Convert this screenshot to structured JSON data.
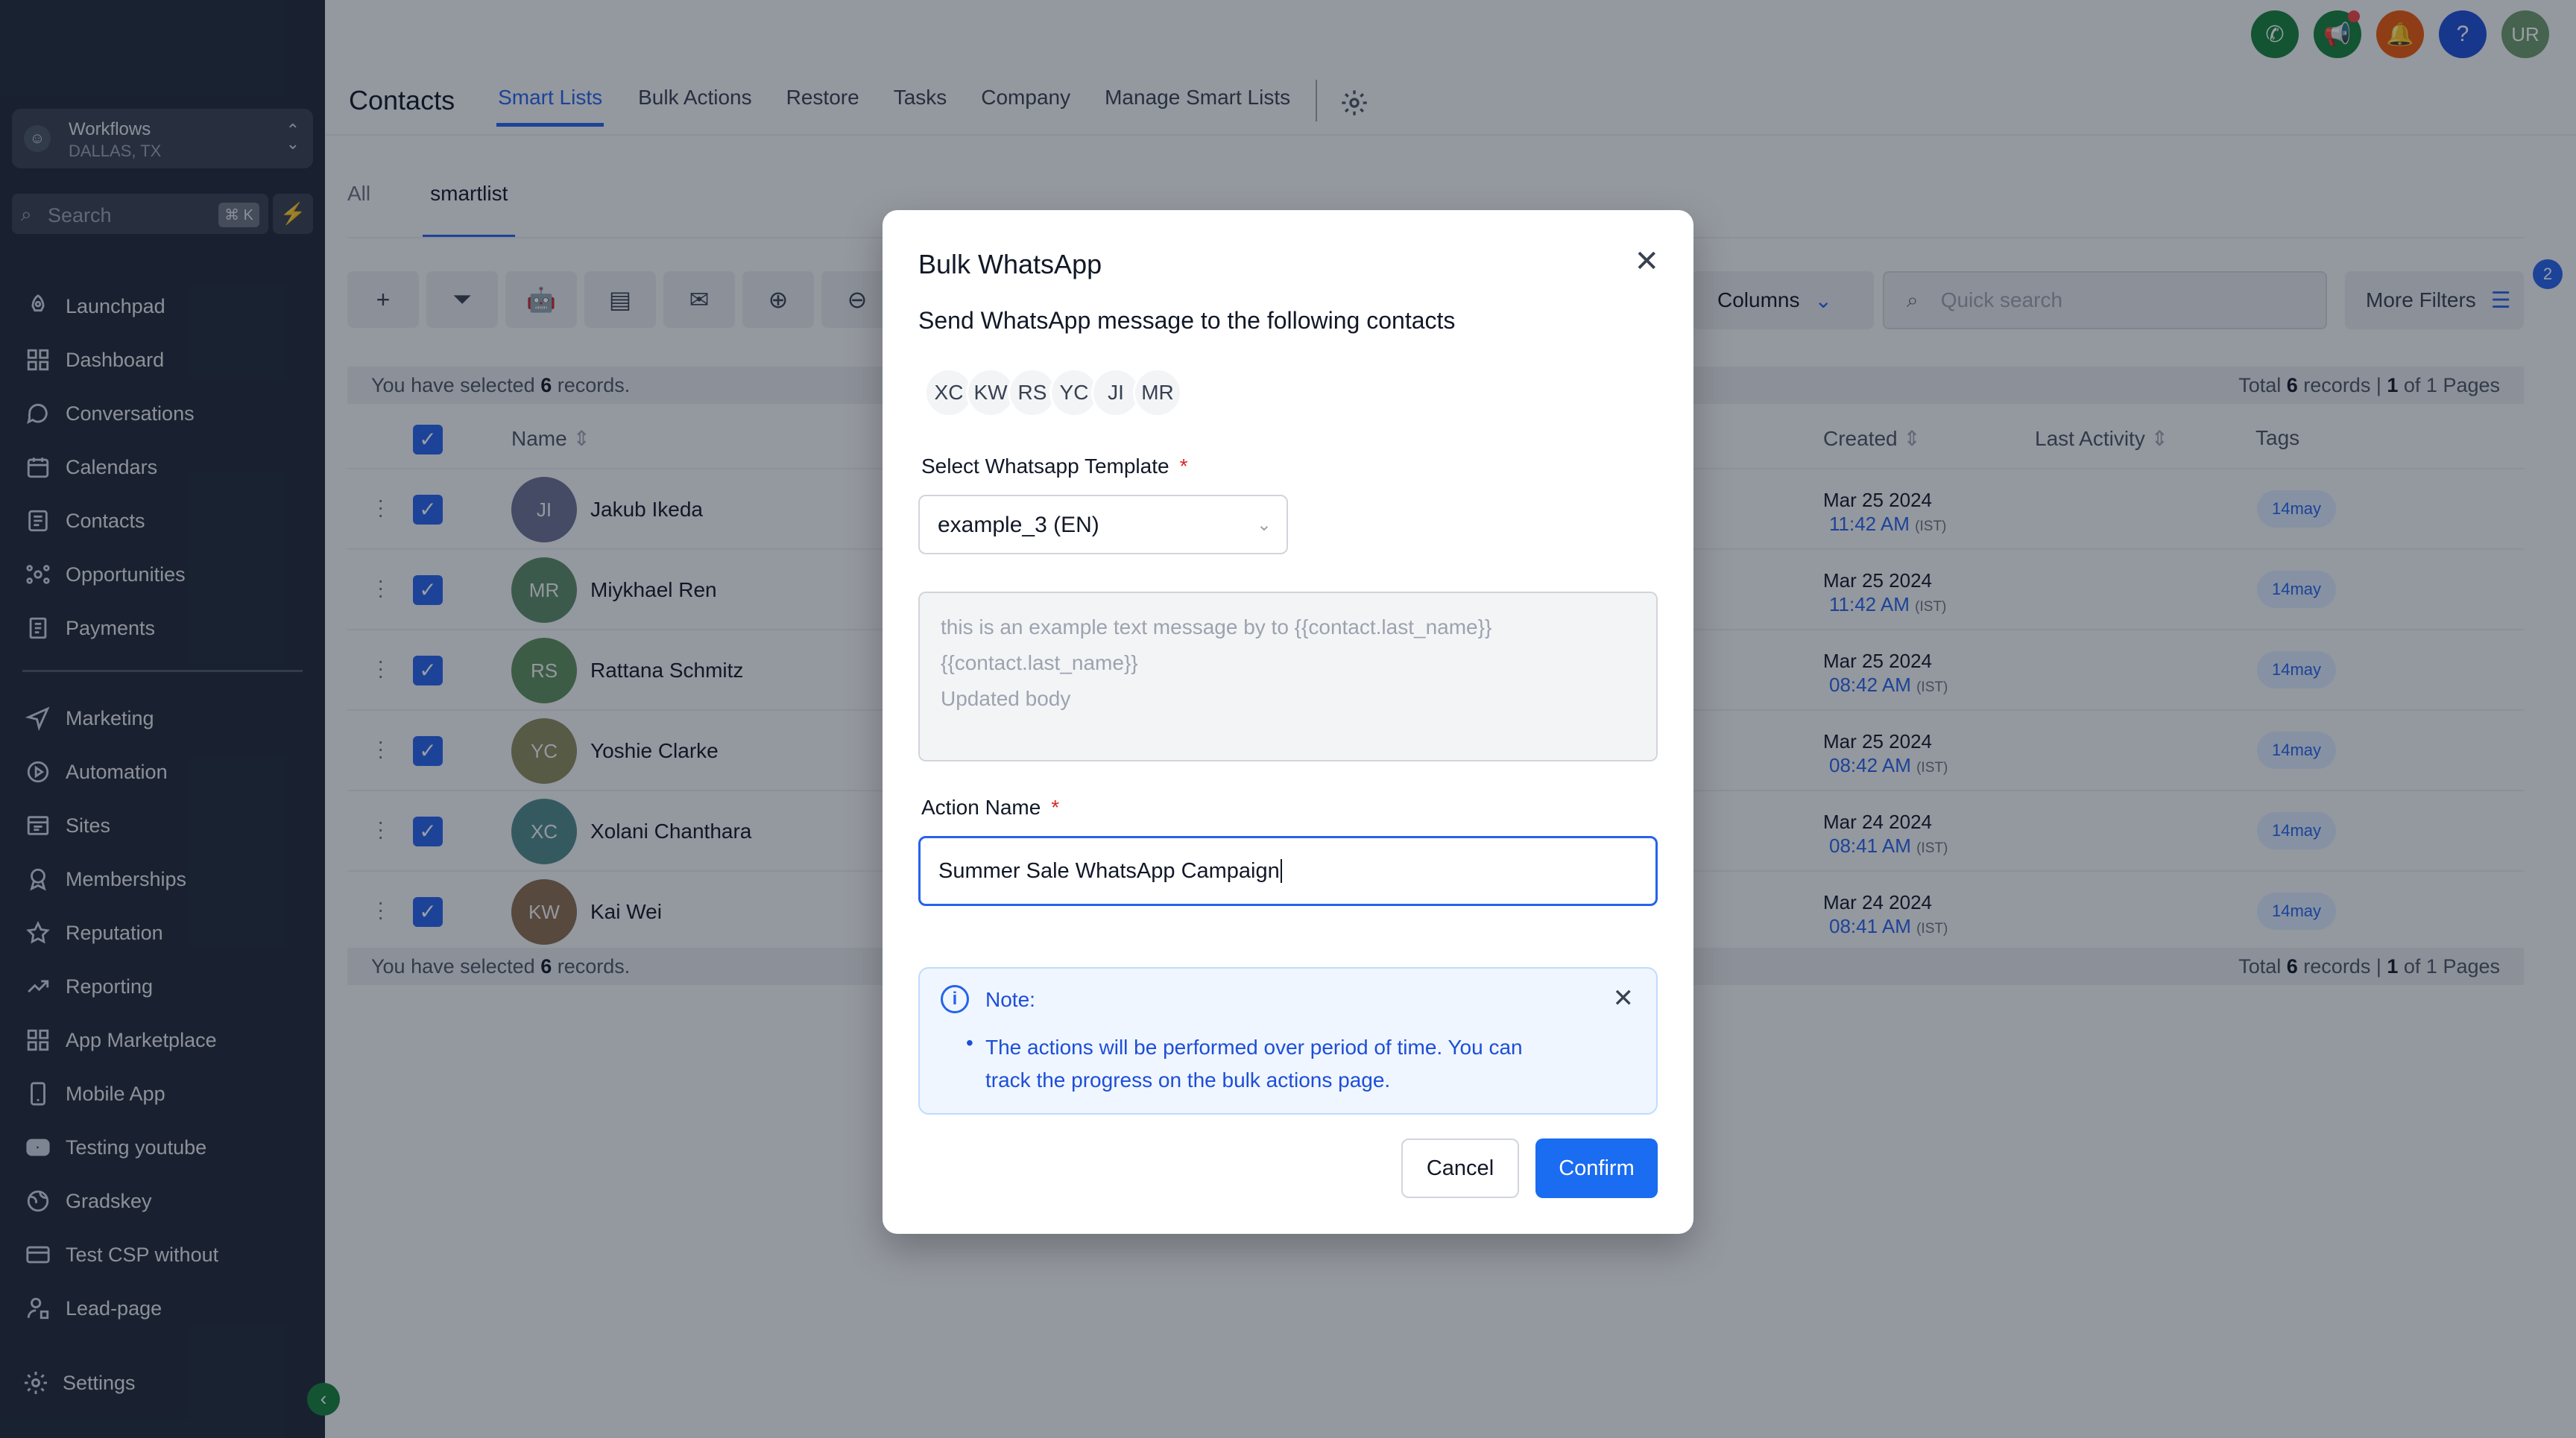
{
  "sidebar": {
    "location": {
      "name": "Workflows",
      "city": "DALLAS, TX",
      "avatar": "☺"
    },
    "search": {
      "placeholder": "Search",
      "shortcut": "⌘ K"
    },
    "items": [
      {
        "label": "Launchpad",
        "icon": "rocket-icon"
      },
      {
        "label": "Dashboard",
        "icon": "dashboard-icon"
      },
      {
        "label": "Conversations",
        "icon": "chat-icon"
      },
      {
        "label": "Calendars",
        "icon": "calendar-icon"
      },
      {
        "label": "Contacts",
        "icon": "contacts-icon"
      },
      {
        "label": "Opportunities",
        "icon": "opportunities-icon"
      },
      {
        "label": "Payments",
        "icon": "payments-icon"
      }
    ],
    "items2": [
      {
        "label": "Marketing",
        "icon": "send-icon"
      },
      {
        "label": "Automation",
        "icon": "automation-icon"
      },
      {
        "label": "Sites",
        "icon": "sites-icon"
      },
      {
        "label": "Memberships",
        "icon": "memberships-icon"
      },
      {
        "label": "Reputation",
        "icon": "star-icon"
      },
      {
        "label": "Reporting",
        "icon": "reporting-icon"
      },
      {
        "label": "App Marketplace",
        "icon": "grid-icon"
      },
      {
        "label": "Mobile App",
        "icon": "mobile-icon"
      },
      {
        "label": "Testing youtube",
        "icon": "youtube-icon"
      },
      {
        "label": "Gradskey",
        "icon": "globe-icon"
      },
      {
        "label": "Test CSP without",
        "icon": "card-icon"
      },
      {
        "label": "Lead-page",
        "icon": "user-lock-icon"
      }
    ],
    "settings_label": "Settings"
  },
  "header": {
    "title": "Contacts",
    "tabs": [
      "Smart Lists",
      "Bulk Actions",
      "Restore",
      "Tasks",
      "Company",
      "Manage Smart Lists"
    ],
    "active_tab": "Smart Lists",
    "user_initials": "UR",
    "colors": {
      "phone": "#15803d",
      "megaphone": "#15803d",
      "bell": "#ea580c",
      "help": "#1d4ed8",
      "avatar": "#6b9a6b"
    }
  },
  "subtabs": [
    "All",
    "smartlist"
  ],
  "toolbar": {
    "columns_label": "Columns",
    "quick_search_placeholder": "Quick search",
    "more_filters_label": "More Filters",
    "filters_badge": "2"
  },
  "selection": {
    "prefix": "You have selected",
    "count": "6",
    "suffix": "records.",
    "total_prefix": "Total",
    "total_count": "6",
    "total_mid": "records |",
    "page": "1",
    "page_mid": "of 1 Pages"
  },
  "table": {
    "headers": {
      "name": "Name",
      "created": "Created",
      "last_activity": "Last Activity",
      "tags": "Tags"
    },
    "rows": [
      {
        "initials": "JI",
        "name": "Jakub Ikeda",
        "date": "Mar 25 2024",
        "time": "11:42 AM",
        "tz": "(IST)",
        "tag": "14may",
        "color": "#6b6f93"
      },
      {
        "initials": "MR",
        "name": "Miykhael Ren",
        "date": "Mar 25 2024",
        "time": "11:42 AM",
        "tz": "(IST)",
        "tag": "14may",
        "color": "#5c8a66"
      },
      {
        "initials": "RS",
        "name": "Rattana Schmitz",
        "date": "Mar 25 2024",
        "time": "08:42 AM",
        "tz": "(IST)",
        "tag": "14may",
        "color": "#5e8e5e"
      },
      {
        "initials": "YC",
        "name": "Yoshie Clarke",
        "date": "Mar 25 2024",
        "time": "08:42 AM",
        "tz": "(IST)",
        "tag": "14may",
        "color": "#8a8a5c"
      },
      {
        "initials": "XC",
        "name": "Xolani Chanthara",
        "date": "Mar 24 2024",
        "time": "08:41 AM",
        "tz": "(IST)",
        "tag": "14may",
        "color": "#4f8a8a"
      },
      {
        "initials": "KW",
        "name": "Kai Wei",
        "date": "Mar 24 2024",
        "time": "08:41 AM",
        "tz": "(IST)",
        "tag": "14may",
        "color": "#8a6d4f"
      }
    ]
  },
  "modal": {
    "title": "Bulk WhatsApp",
    "subtitle": "Send WhatsApp message to the following contacts",
    "chips": [
      "XC",
      "KW",
      "RS",
      "YC",
      "JI",
      "MR"
    ],
    "template_label": "Select Whatsapp Template",
    "required_mark": "*",
    "template_value": "example_3 (EN)",
    "body_line1": "this is an example text message by  to {{contact.last_name}}",
    "body_line2": "{{contact.last_name}}",
    "body_line3": "Updated body",
    "action_label": "Action Name",
    "action_value": "Summer Sale WhatsApp Campaign",
    "note_title": "Note:",
    "note_body": "The actions will be performed over period of time. You can track the progress on the bulk actions page.",
    "cancel_label": "Cancel",
    "confirm_label": "Confirm"
  }
}
